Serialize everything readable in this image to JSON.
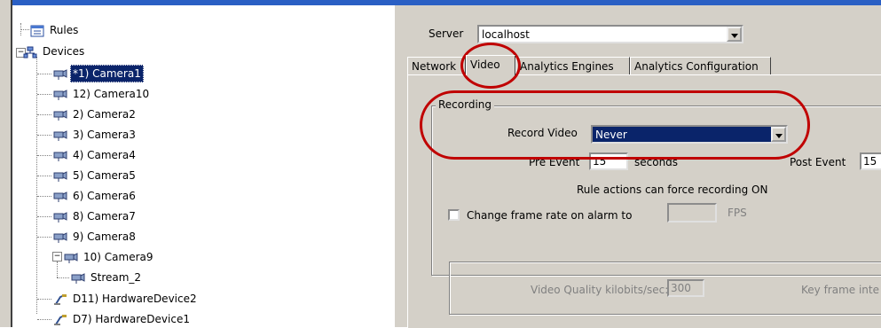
{
  "tree": {
    "items": [
      {
        "label": "Rules",
        "icon": "rules-icon"
      },
      {
        "label": "Devices",
        "icon": "devices-icon"
      },
      {
        "label": "*1) Camera1",
        "icon": "camera-icon",
        "selected": true
      },
      {
        "label": "12) Camera10",
        "icon": "camera-icon"
      },
      {
        "label": "2) Camera2",
        "icon": "camera-icon"
      },
      {
        "label": "3) Camera3",
        "icon": "camera-icon"
      },
      {
        "label": "4) Camera4",
        "icon": "camera-icon"
      },
      {
        "label": "5) Camera5",
        "icon": "camera-icon"
      },
      {
        "label": "6) Camera6",
        "icon": "camera-icon"
      },
      {
        "label": "8) Camera7",
        "icon": "camera-icon"
      },
      {
        "label": "9) Camera8",
        "icon": "camera-icon"
      },
      {
        "label": "10) Camera9",
        "icon": "camera-icon"
      },
      {
        "label": "Stream_2",
        "icon": "camera-icon"
      },
      {
        "label": "D11) HardwareDevice2",
        "icon": "hardware-device-icon"
      },
      {
        "label": "D7) HardwareDevice1",
        "icon": "hardware-device-icon"
      }
    ]
  },
  "server": {
    "label": "Server",
    "value": "localhost"
  },
  "tabs": [
    {
      "label": "Network"
    },
    {
      "label": "Video",
      "active": true
    },
    {
      "label": "Analytics Engines"
    },
    {
      "label": "Analytics Configuration"
    }
  ],
  "recording": {
    "group_title": "Recording",
    "record_video_label": "Record Video",
    "record_video_value": "Never",
    "pre_event_label": "Pre Event",
    "pre_event_value": "15",
    "pre_event_unit": "seconds",
    "post_event_label": "Post Event",
    "post_event_value": "15",
    "note": "Rule actions can force recording ON",
    "frame_rate_label": "Change frame rate on alarm to",
    "frame_rate_value": "",
    "frame_rate_unit": "FPS"
  },
  "quality": {
    "label": "Video Quality kilobits/sec:",
    "value": "300",
    "keyframe_label": "Key frame inte"
  },
  "colors": {
    "selection": "#0a246a",
    "highlight": "#c00000",
    "chrome": "#d4d0c8"
  }
}
